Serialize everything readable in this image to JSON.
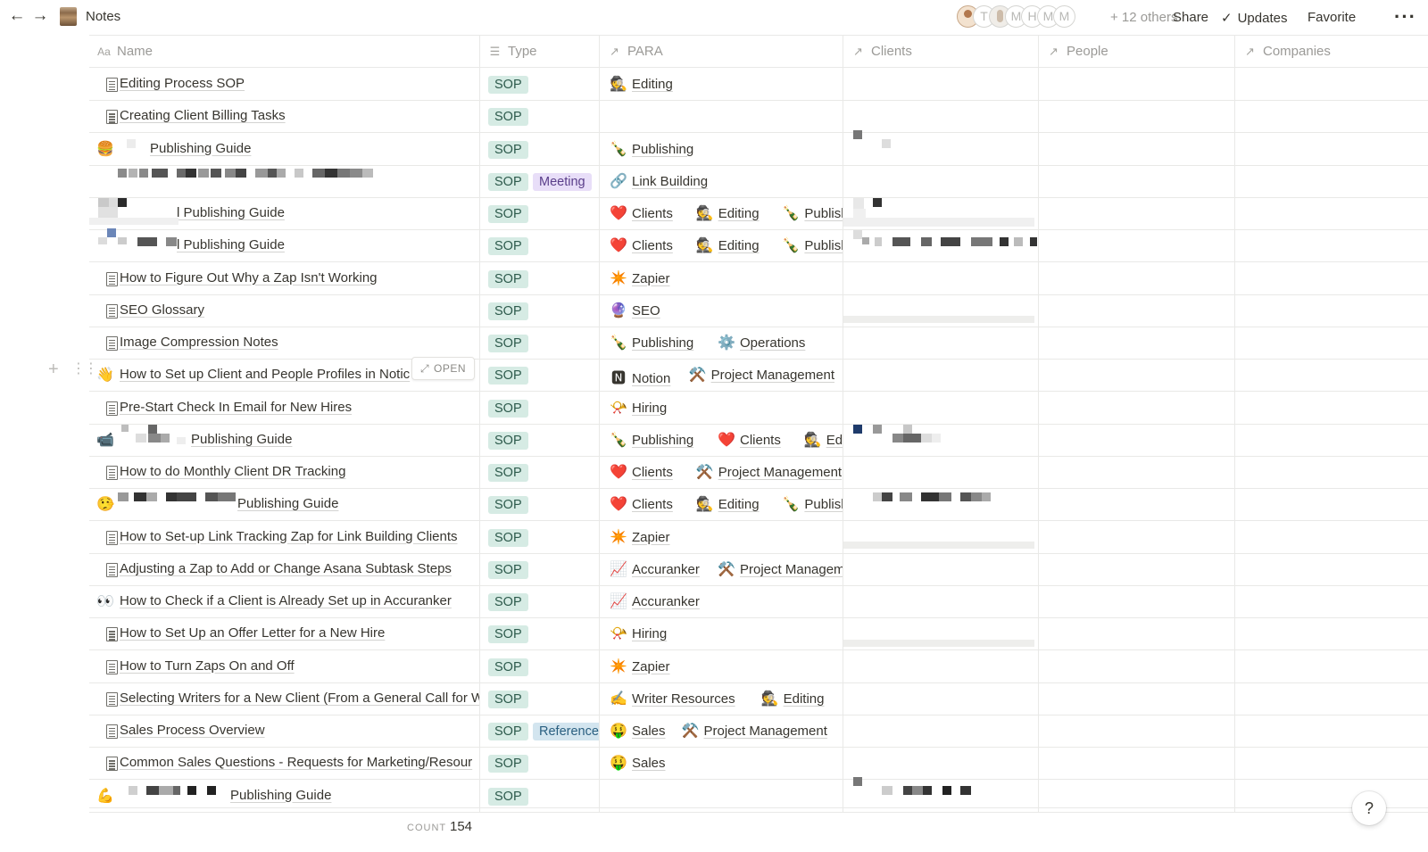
{
  "window": {
    "title": "Notes",
    "others_count": "+ 12 others",
    "actions": {
      "share": "Share",
      "updates": "Updates",
      "favorite": "Favorite"
    },
    "avatars": [
      "T",
      "M",
      "H",
      "M",
      "M"
    ]
  },
  "columns": {
    "name": "Name",
    "type": "Type",
    "para": "PARA",
    "clients": "Clients",
    "people": "People",
    "companies": "Companies"
  },
  "rows": [
    {
      "icon": "doc",
      "title": "Editing Process SOP",
      "type": [
        "SOP"
      ],
      "para": [
        {
          "icon": "🕵️",
          "label": "Editing"
        }
      ]
    },
    {
      "icon": "doc",
      "title": "Creating Client Billing Tasks",
      "type": [
        "SOP"
      ],
      "para": []
    },
    {
      "icon": "🍔",
      "title": "Publishing Guide",
      "type": [
        "SOP"
      ],
      "para": [
        {
          "icon": "🍾",
          "label": "Publishing"
        }
      ]
    },
    {
      "icon": "",
      "title": "",
      "type": [
        "SOP",
        "Meeting"
      ],
      "para": [
        {
          "icon": "🔗",
          "label": "Link Building"
        }
      ]
    },
    {
      "icon": "",
      "title": "l Publishing Guide",
      "type": [
        "SOP"
      ],
      "para": [
        {
          "icon": "❤️",
          "label": "Clients"
        },
        {
          "icon": "🕵️",
          "label": "Editing"
        },
        {
          "icon": "🍾",
          "label": "Publishin"
        }
      ]
    },
    {
      "icon": "",
      "title": "l Publishing Guide",
      "type": [
        "SOP"
      ],
      "para": [
        {
          "icon": "❤️",
          "label": "Clients"
        },
        {
          "icon": "🕵️",
          "label": "Editing"
        },
        {
          "icon": "🍾",
          "label": "Publishin"
        }
      ]
    },
    {
      "icon": "doc",
      "title": "How to Figure Out Why a Zap Isn't Working",
      "type": [
        "SOP"
      ],
      "para": [
        {
          "icon": "✴️",
          "label": "Zapier"
        }
      ]
    },
    {
      "icon": "doc",
      "title": "SEO Glossary",
      "type": [
        "SOP"
      ],
      "para": [
        {
          "icon": "🔮",
          "label": "SEO"
        }
      ]
    },
    {
      "icon": "doc",
      "title": "Image Compression Notes",
      "type": [
        "SOP"
      ],
      "para": [
        {
          "icon": "🍾",
          "label": "Publishing"
        },
        {
          "icon": "⚙️",
          "label": "Operations"
        }
      ]
    },
    {
      "icon": "👋",
      "title": "How to Set up Client and People Profiles in Notic",
      "type": [
        "SOP"
      ],
      "para": [
        {
          "icon": "🅽",
          "label": "Notion"
        },
        {
          "icon": "⚒️",
          "label": "Project Management"
        }
      ]
    },
    {
      "icon": "doc",
      "title": "Pre-Start Check In Email for New Hires",
      "type": [
        "SOP"
      ],
      "para": [
        {
          "icon": "📯",
          "label": "Hiring"
        }
      ]
    },
    {
      "icon": "📹",
      "title": "Publishing Guide",
      "type": [
        "SOP"
      ],
      "para": [
        {
          "icon": "🍾",
          "label": "Publishing"
        },
        {
          "icon": "❤️",
          "label": "Clients"
        },
        {
          "icon": "🕵️",
          "label": "Editin"
        }
      ]
    },
    {
      "icon": "doc",
      "title": "How to do Monthly Client DR Tracking",
      "type": [
        "SOP"
      ],
      "para": [
        {
          "icon": "❤️",
          "label": "Clients"
        },
        {
          "icon": "⚒️",
          "label": "Project Management"
        }
      ]
    },
    {
      "icon": "🤥",
      "title": "Publishing Guide",
      "type": [
        "SOP"
      ],
      "para": [
        {
          "icon": "❤️",
          "label": "Clients"
        },
        {
          "icon": "🕵️",
          "label": "Editing"
        },
        {
          "icon": "🍾",
          "label": "Publishin"
        }
      ]
    },
    {
      "icon": "doc",
      "title": "How to Set-up Link Tracking Zap for Link Building Clients",
      "type": [
        "SOP"
      ],
      "para": [
        {
          "icon": "✴️",
          "label": "Zapier"
        }
      ]
    },
    {
      "icon": "doc",
      "title": "Adjusting a Zap to Add or Change Asana Subtask Steps",
      "type": [
        "SOP"
      ],
      "para": [
        {
          "icon": "📈",
          "label": "Accuranker"
        },
        {
          "icon": "⚒️",
          "label": "Project Managem"
        }
      ]
    },
    {
      "icon": "👀",
      "title": "How to Check if a Client is Already Set up in Accuranker",
      "type": [
        "SOP"
      ],
      "para": [
        {
          "icon": "📈",
          "label": "Accuranker"
        }
      ]
    },
    {
      "icon": "doc",
      "title": "How to Set Up an Offer Letter for a New Hire",
      "type": [
        "SOP"
      ],
      "para": [
        {
          "icon": "📯",
          "label": "Hiring"
        }
      ]
    },
    {
      "icon": "doc",
      "title": "How to Turn Zaps On and Off",
      "type": [
        "SOP"
      ],
      "para": [
        {
          "icon": "✴️",
          "label": "Zapier"
        }
      ]
    },
    {
      "icon": "doc",
      "title": "Selecting Writers for a New Client (From a General Call for W",
      "type": [
        "SOP"
      ],
      "para": [
        {
          "icon": "✍️",
          "label": "Writer Resources"
        },
        {
          "icon": "🕵️",
          "label": "Editing"
        },
        {
          "icon": "❤️",
          "label": ""
        }
      ]
    },
    {
      "icon": "doc",
      "title": "Sales Process Overview",
      "type": [
        "SOP",
        "Reference"
      ],
      "para": [
        {
          "icon": "🤑",
          "label": "Sales"
        },
        {
          "icon": "⚒️",
          "label": "Project Management"
        }
      ]
    },
    {
      "icon": "doc",
      "title": "Common Sales Questions - Requests for Marketing/Resour",
      "type": [
        "SOP"
      ],
      "para": [
        {
          "icon": "🤑",
          "label": "Sales"
        }
      ]
    },
    {
      "icon": "💪",
      "title": "Publishing Guide",
      "type": [
        "SOP"
      ],
      "para": []
    }
  ],
  "hover": {
    "open_label": "OPEN"
  },
  "footer": {
    "count_label": "COUNT",
    "count_value": "154"
  },
  "help_label": "?"
}
